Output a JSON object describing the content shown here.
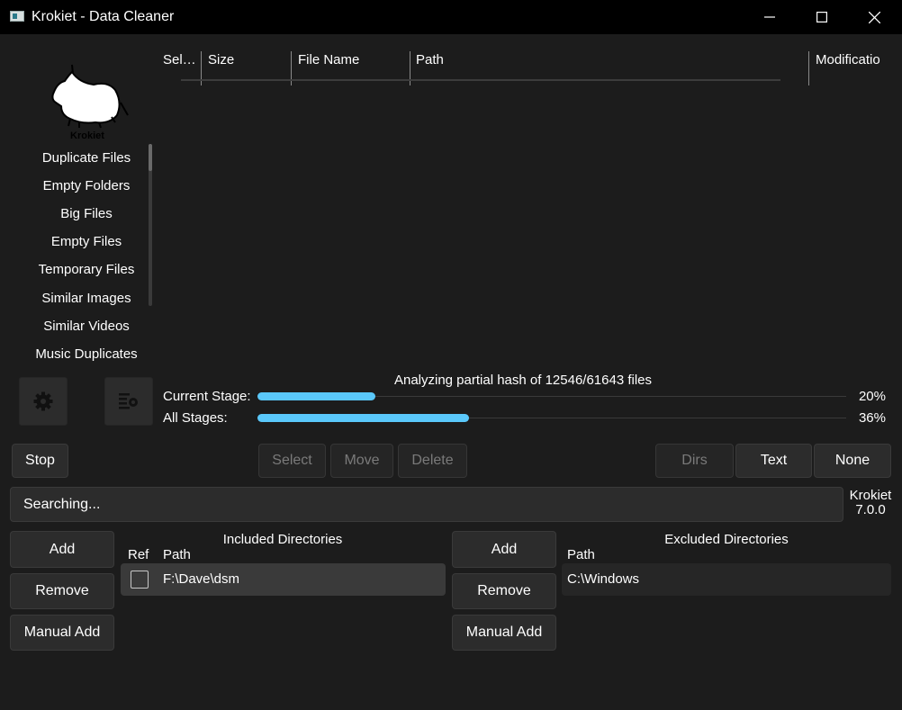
{
  "window": {
    "title": "Krokiet - Data Cleaner",
    "controls": {
      "minimize": "─",
      "maximize": "☐",
      "close": "✕"
    }
  },
  "logo": {
    "text": "Krokiet"
  },
  "sidebar": {
    "items": [
      {
        "label": "Duplicate Files"
      },
      {
        "label": "Empty Folders"
      },
      {
        "label": "Big Files"
      },
      {
        "label": "Empty Files"
      },
      {
        "label": "Temporary Files"
      },
      {
        "label": "Similar Images"
      },
      {
        "label": "Similar Videos"
      },
      {
        "label": "Music Duplicates"
      }
    ]
  },
  "table": {
    "columns": [
      "Sel…",
      "Size",
      "File Name",
      "Path",
      "Modificatio"
    ]
  },
  "progress": {
    "status": "Analyzing partial hash of 12546/61643 files",
    "current_label": "Current Stage:",
    "current_percent": "20%",
    "current_value": 0.2,
    "all_label": "All Stages:",
    "all_percent": "36%",
    "all_value": 0.36,
    "accent": "#5ac8fa"
  },
  "actions": {
    "stop": "Stop",
    "select": "Select",
    "move": "Move",
    "delete": "Delete",
    "dirs": "Dirs",
    "text": "Text",
    "none": "None"
  },
  "search": {
    "text": "Searching..."
  },
  "version": {
    "name": "Krokiet",
    "number": "7.0.0"
  },
  "included": {
    "title": "Included Directories",
    "add": "Add",
    "remove": "Remove",
    "manual_add": "Manual Add",
    "ref_header": "Ref",
    "path_header": "Path",
    "rows": [
      {
        "path": "F:\\Dave\\dsm",
        "ref": false
      }
    ]
  },
  "excluded": {
    "title": "Excluded Directories",
    "add": "Add",
    "remove": "Remove",
    "manual_add": "Manual Add",
    "path_header": "Path",
    "rows": [
      {
        "path": "C:\\Windows"
      }
    ]
  },
  "icons": {
    "settings": "gear-icon",
    "subsettings": "list-settings-icon"
  }
}
